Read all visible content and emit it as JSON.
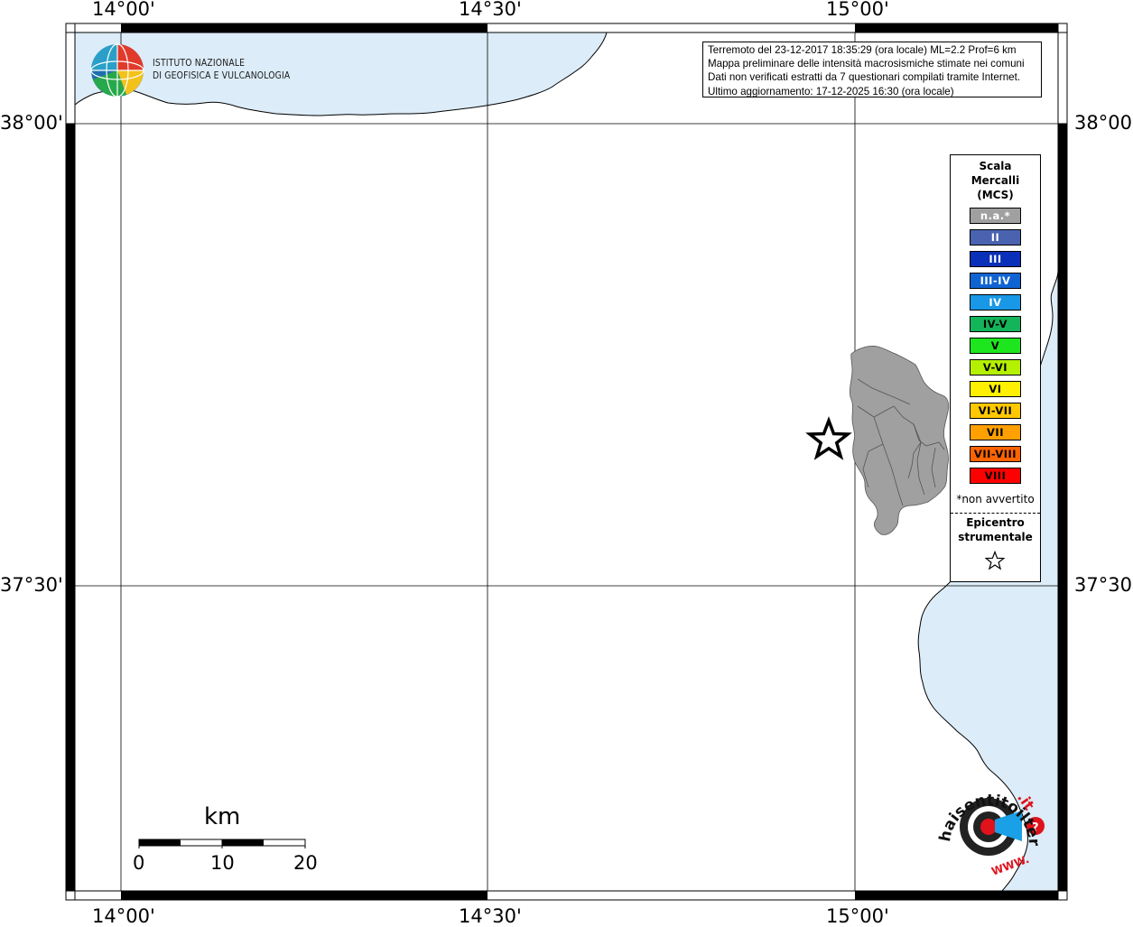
{
  "info": {
    "lines": [
      "Terremoto del 23-12-2017 18:35:29 (ora locale) ML=2.2 Prof=6 km",
      "Mappa preliminare delle intensità macrosismiche stimate nei comuni",
      "Dati non verificati estratti da 7 questionari compilati tramite Internet.",
      "Ultimo aggiornamento: 17-12-2025 16:30 (ora locale)"
    ]
  },
  "institute": {
    "line1": "ISTITUTO NAZIONALE",
    "line2": "DI GEOFISICA E VULCANOLOGIA",
    "logo_icon": "ingv-globe-logo"
  },
  "axes": {
    "lon_labels": [
      "14°00'",
      "14°30'",
      "15°00'"
    ],
    "lat_labels": [
      "38°00'",
      "37°30'"
    ]
  },
  "legend": {
    "title_lines": [
      "Scala",
      "Mercalli",
      "(MCS)"
    ],
    "classes": [
      {
        "label": "n.a.*",
        "color": "#a0a0a0",
        "text_color": "#ffffff"
      },
      {
        "label": "II",
        "color": "#4a63b0",
        "text_color": "#ffffff"
      },
      {
        "label": "III",
        "color": "#0a2fb8",
        "text_color": "#ffffff"
      },
      {
        "label": "III-IV",
        "color": "#1064d2",
        "text_color": "#ffffff"
      },
      {
        "label": "IV",
        "color": "#1898e6",
        "text_color": "#ffffff"
      },
      {
        "label": "IV-V",
        "color": "#14b45a",
        "text_color": "#000000"
      },
      {
        "label": "V",
        "color": "#1ee61e",
        "text_color": "#000000"
      },
      {
        "label": "V-VI",
        "color": "#b4f000",
        "text_color": "#000000"
      },
      {
        "label": "VI",
        "color": "#fff000",
        "text_color": "#000000"
      },
      {
        "label": "VI-VII",
        "color": "#ffc800",
        "text_color": "#000000"
      },
      {
        "label": "VII",
        "color": "#ffa000",
        "text_color": "#000000"
      },
      {
        "label": "VII-VIII",
        "color": "#ff6400",
        "text_color": "#000000"
      },
      {
        "label": "VIII",
        "color": "#ff0000",
        "text_color": "#000000"
      }
    ],
    "not_felt_note": "*non avvertito",
    "epicenter_lines": [
      "Epicentro",
      "strumentale"
    ],
    "epicenter_icon": "star-icon"
  },
  "scale_bar": {
    "unit": "km",
    "ticks": [
      "0",
      "10",
      "20"
    ]
  },
  "watermark": {
    "name": "haisentitoilterremoto-logo",
    "text_main": "haisentitoilterremoto",
    "text_it": ".it",
    "text_www": "WWW."
  },
  "colors": {
    "sea": "#dcecf8",
    "municipality_fill": "#a0a0a0",
    "coast": "#000000"
  }
}
